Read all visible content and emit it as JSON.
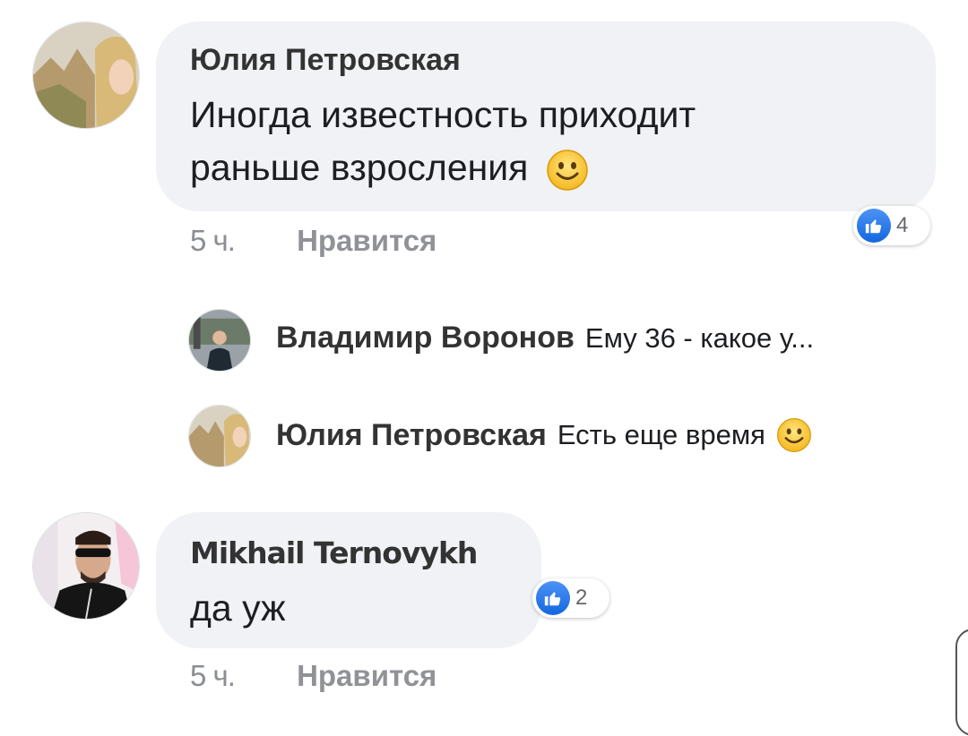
{
  "comments": [
    {
      "author": "Юлия Петровская",
      "text_line1": "Иногда известность приходит",
      "text_line2": "раньше взросления",
      "emoji": "smile-emoji",
      "time": "5 ч.",
      "like_label": "Нравится",
      "reaction_count": "4",
      "replies": [
        {
          "author": "Владимир Воронов",
          "text": "Ему 36 - какое у..."
        },
        {
          "author": "Юлия Петровская",
          "text": "Есть еще время",
          "emoji": "smile-emoji"
        }
      ]
    },
    {
      "author": "Mikhail Ternovykh",
      "text_line1": "да уж",
      "time": "5 ч.",
      "like_label": "Нравится",
      "reaction_count": "2"
    }
  ],
  "colors": {
    "bubble": "#f0f2f5",
    "like_blue": "#1877f2",
    "meta_gray": "#8a8d91"
  }
}
